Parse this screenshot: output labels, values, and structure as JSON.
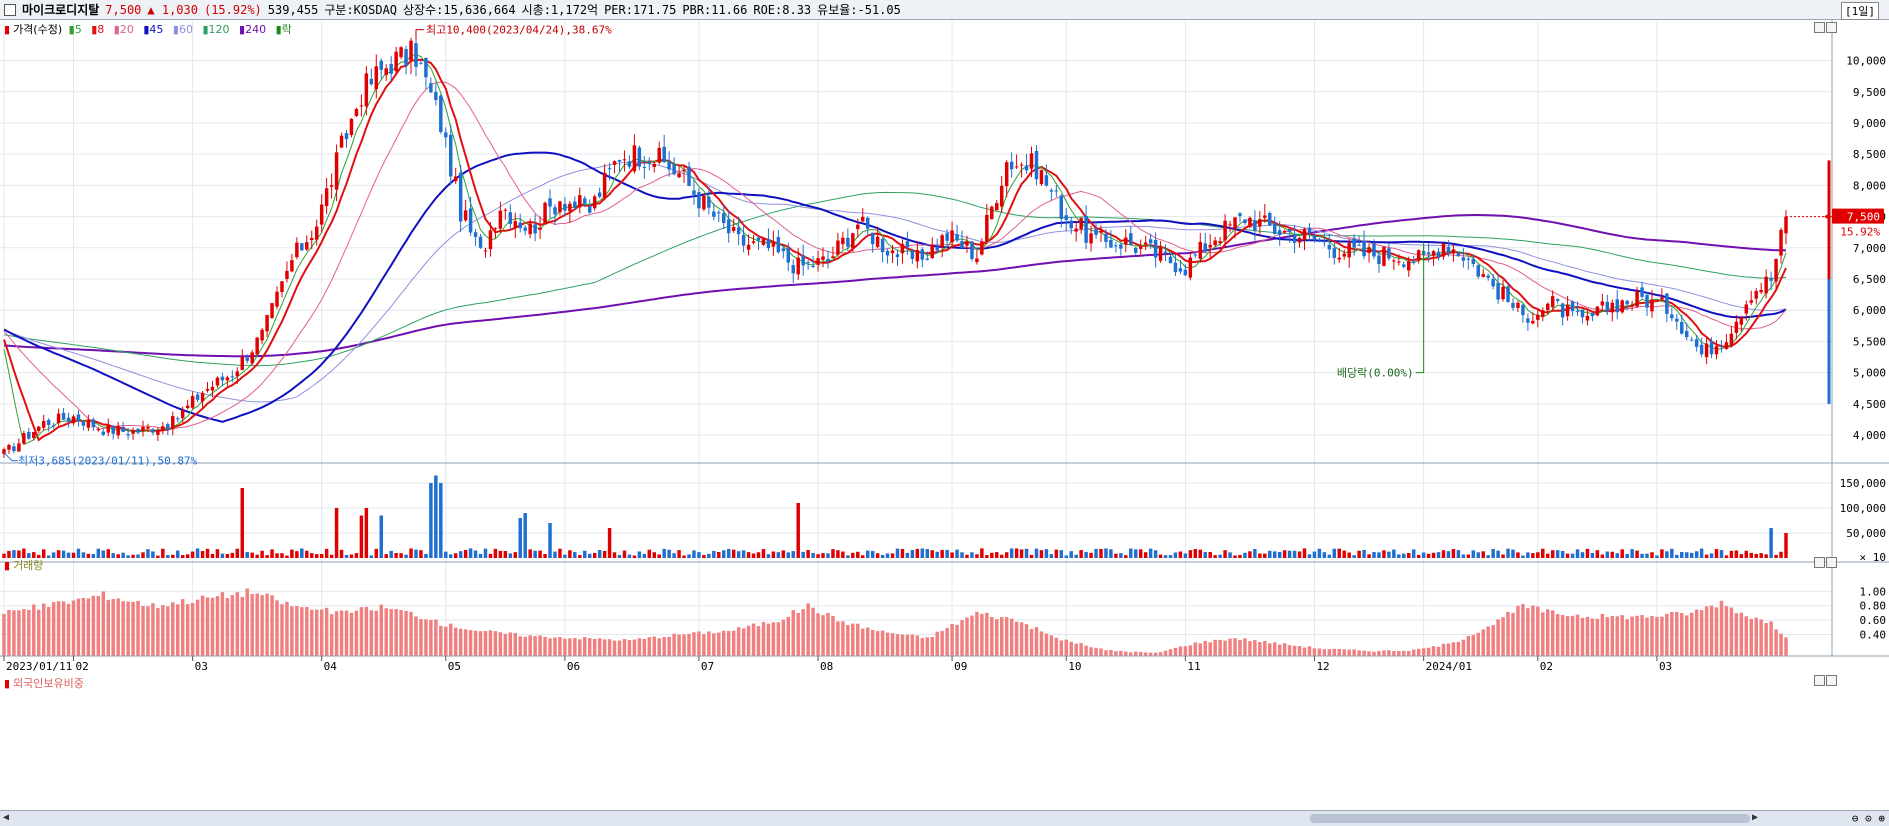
{
  "header": {
    "name": "마이크로디지탈",
    "price": "7,500",
    "change": "▲ 1,030",
    "change_pct": "(15.92%)",
    "volume": "539,455",
    "market": "구분:KOSDAQ",
    "listed": "상장수:15,636,664",
    "mktcap": "시총:1,172억",
    "per": "PER:171.75",
    "pbr": "PBR:11.66",
    "roe": "ROE:8.33",
    "float": "유보율:-51.05",
    "period": "[1일]"
  },
  "legends": {
    "price_title": "가격(수정)",
    "ma": [
      "5",
      "8",
      "20",
      "45",
      "60",
      "120",
      "240"
    ],
    "drop": "락",
    "volume_title": "거래량",
    "foreign_title": "외국인보유비중"
  },
  "colors": {
    "up": "#e00000",
    "down": "#1f6fd0",
    "ma5": "#2fa02f",
    "ma8": "#e01010",
    "ma20": "#e06090",
    "ma45": "#1010c0",
    "ma60": "#9090e0",
    "ma120": "#30a060",
    "ma240": "#7010b0",
    "foreign": "#f08080"
  },
  "annotations": {
    "high": "최고10,400(2023/04/24),38.67%",
    "low": "최저3,685(2023/01/11),50.87%",
    "dividend": "배당락(0.00%)",
    "last_price": "7,500",
    "last_pct": "15.92%",
    "vol_unit": "× 10"
  },
  "chart_data": [
    {
      "type": "candlestick",
      "title": "가격(수정)",
      "x": [
        "2023/01/11",
        "02",
        "03",
        "04",
        "05",
        "06",
        "07",
        "08",
        "09",
        "10",
        "11",
        "12",
        "2024/01",
        "02",
        "03"
      ],
      "yticks": [
        4000,
        4500,
        5000,
        5500,
        6000,
        6500,
        7000,
        7500,
        8000,
        8500,
        9000,
        9500,
        10000
      ],
      "ylim": [
        3600,
        10650
      ],
      "close_anchors": [
        [
          0,
          3700
        ],
        [
          8,
          4200
        ],
        [
          14,
          4300
        ],
        [
          20,
          4100
        ],
        [
          26,
          4050
        ],
        [
          34,
          4200
        ],
        [
          40,
          4700
        ],
        [
          46,
          5000
        ],
        [
          52,
          5600
        ],
        [
          58,
          6800
        ],
        [
          63,
          7400
        ],
        [
          68,
          8600
        ],
        [
          72,
          9500
        ],
        [
          78,
          10000
        ],
        [
          83,
          10100
        ],
        [
          88,
          9000
        ],
        [
          92,
          7600
        ],
        [
          96,
          6900
        ],
        [
          100,
          7700
        ],
        [
          106,
          7300
        ],
        [
          112,
          7800
        ],
        [
          118,
          7600
        ],
        [
          124,
          8500
        ],
        [
          130,
          8500
        ],
        [
          136,
          8200
        ],
        [
          142,
          7600
        ],
        [
          148,
          7100
        ],
        [
          154,
          7000
        ],
        [
          160,
          6700
        ],
        [
          166,
          6800
        ],
        [
          172,
          7400
        ],
        [
          178,
          7000
        ],
        [
          184,
          6800
        ],
        [
          190,
          7200
        ],
        [
          196,
          6900
        ],
        [
          202,
          8400
        ],
        [
          208,
          8300
        ],
        [
          214,
          7500
        ],
        [
          220,
          7100
        ],
        [
          226,
          7100
        ],
        [
          232,
          6900
        ],
        [
          238,
          6700
        ],
        [
          244,
          7200
        ],
        [
          250,
          7500
        ],
        [
          256,
          7300
        ],
        [
          262,
          7200
        ],
        [
          268,
          7000
        ],
        [
          274,
          6900
        ],
        [
          280,
          6900
        ],
        [
          286,
          6800
        ],
        [
          290,
          7100
        ],
        [
          294,
          6900
        ],
        [
          300,
          6400
        ],
        [
          306,
          5900
        ],
        [
          312,
          6100
        ],
        [
          318,
          5800
        ],
        [
          324,
          6100
        ],
        [
          330,
          6200
        ],
        [
          336,
          6000
        ],
        [
          342,
          5300
        ],
        [
          347,
          5600
        ],
        [
          352,
          6300
        ],
        [
          356,
          6500
        ],
        [
          359,
          7500
        ]
      ],
      "high": {
        "label": "최고10,400(2023/04/24),38.67%",
        "value": 10400,
        "date": "2023/04/24"
      },
      "low": {
        "label": "최저3,685(2023/01/11),50.87%",
        "value": 3685,
        "date": "2023/01/11"
      },
      "last": 7500
    },
    {
      "type": "bar",
      "title": "거래량",
      "yticks": [
        50000,
        100000,
        150000
      ],
      "unit": "× 10",
      "ylim": [
        0,
        180000
      ],
      "base": 12000,
      "spikes": [
        [
          48,
          140000
        ],
        [
          86,
          150000
        ],
        [
          87,
          165000
        ],
        [
          88,
          150000
        ],
        [
          67,
          100000
        ],
        [
          72,
          85000
        ],
        [
          73,
          100000
        ],
        [
          76,
          85000
        ],
        [
          104,
          80000
        ],
        [
          105,
          90000
        ],
        [
          110,
          70000
        ],
        [
          122,
          60000
        ],
        [
          160,
          110000
        ],
        [
          356,
          60000
        ],
        [
          359,
          50000
        ]
      ]
    },
    {
      "type": "bar",
      "title": "외국인보유비중",
      "yticks": [
        0.4,
        0.6,
        0.8,
        1.0
      ],
      "ylim": [
        0.1,
        1.2
      ],
      "anchors": [
        [
          0,
          0.7
        ],
        [
          10,
          0.82
        ],
        [
          20,
          0.95
        ],
        [
          30,
          0.8
        ],
        [
          40,
          0.9
        ],
        [
          50,
          1.0
        ],
        [
          58,
          0.8
        ],
        [
          68,
          0.7
        ],
        [
          76,
          0.78
        ],
        [
          82,
          0.7
        ],
        [
          88,
          0.55
        ],
        [
          96,
          0.45
        ],
        [
          106,
          0.38
        ],
        [
          116,
          0.35
        ],
        [
          126,
          0.32
        ],
        [
          136,
          0.4
        ],
        [
          146,
          0.45
        ],
        [
          156,
          0.6
        ],
        [
          162,
          0.8
        ],
        [
          168,
          0.6
        ],
        [
          176,
          0.45
        ],
        [
          186,
          0.35
        ],
        [
          196,
          0.7
        ],
        [
          204,
          0.6
        ],
        [
          212,
          0.35
        ],
        [
          222,
          0.18
        ],
        [
          232,
          0.14
        ],
        [
          240,
          0.28
        ],
        [
          248,
          0.35
        ],
        [
          256,
          0.28
        ],
        [
          266,
          0.2
        ],
        [
          276,
          0.17
        ],
        [
          284,
          0.18
        ],
        [
          292,
          0.28
        ],
        [
          300,
          0.55
        ],
        [
          306,
          0.8
        ],
        [
          312,
          0.7
        ],
        [
          320,
          0.65
        ],
        [
          330,
          0.65
        ],
        [
          340,
          0.7
        ],
        [
          346,
          0.85
        ],
        [
          350,
          0.7
        ],
        [
          356,
          0.55
        ],
        [
          359,
          0.38
        ]
      ]
    }
  ]
}
